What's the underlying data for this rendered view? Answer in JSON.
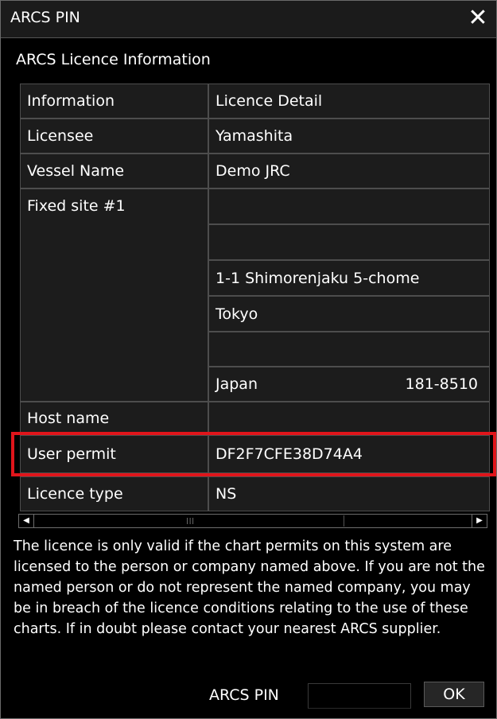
{
  "window": {
    "title": "ARCS PIN",
    "close_icon": "close-icon"
  },
  "section_title": "ARCS Licence Information",
  "table": {
    "headers": [
      "Information",
      "Licence Detail"
    ],
    "licensee": {
      "label": "Licensee",
      "value": "Yamashita"
    },
    "vessel": {
      "label": "Vessel Name",
      "value": "Demo JRC"
    },
    "fixed_site": {
      "label": "Fixed site #1",
      "lines": [
        "",
        "",
        "1-1 Shimorenjaku 5-chome",
        "Tokyo",
        ""
      ],
      "country": "Japan",
      "postcode": "181-8510"
    },
    "host": {
      "label": "Host name",
      "value": ""
    },
    "user_permit": {
      "label": "User permit",
      "value": "DF2F7CFE38D74A4"
    },
    "licence_type": {
      "label": "Licence type",
      "value": "NS"
    }
  },
  "highlight_color": "#e0151b",
  "scrollbar": {
    "left_icon": "arrow-left-icon",
    "right_icon": "arrow-right-icon",
    "grip": "|||"
  },
  "notice": "The licence is only valid if the chart permits on this system are licensed to the person or company named above. If you are not the named person or do not represent the named company,  you may be in breach of the licence conditions relating to the use of these charts. If in doubt please contact your nearest ARCS supplier.",
  "footer": {
    "pin_label": "ARCS PIN",
    "pin_value": "",
    "ok_label": "OK"
  }
}
